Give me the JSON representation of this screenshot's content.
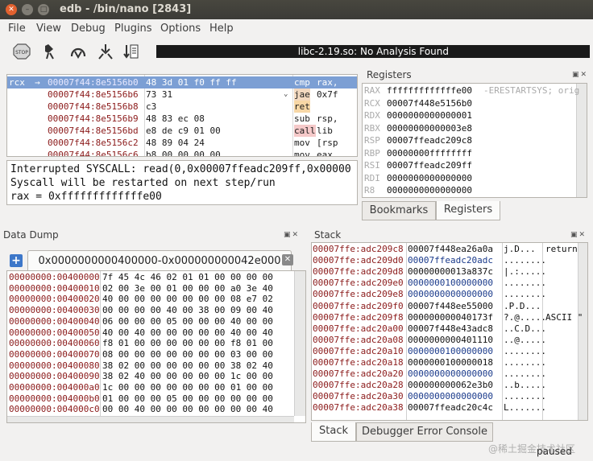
{
  "window": {
    "title": "edb - /bin/nano [2843]"
  },
  "menu": [
    "File",
    "View",
    "Debug",
    "Plugins",
    "Options",
    "Help"
  ],
  "toolbar": {
    "icons": [
      "stop-icon",
      "run-icon",
      "step-into-icon",
      "step-over-icon",
      "step-out-icon"
    ],
    "status_message": "libc-2.19.so: No Analysis Found"
  },
  "disassembly": {
    "rows": [
      {
        "label": "rcx",
        "addr": "00007f44:8e5156b0",
        "bytes": "48 3d 01 f0 ff ff",
        "mn": "cmp",
        "op": "rax,",
        "selected": true
      },
      {
        "label": "",
        "addr": "00007f44:8e5156b6",
        "bytes": "73 31",
        "mn": "jae",
        "op": "0x7f",
        "hl": "jmp"
      },
      {
        "label": "",
        "addr": "00007f44:8e5156b8",
        "bytes": "c3",
        "mn": "ret",
        "op": "",
        "hl": "ret"
      },
      {
        "label": "",
        "addr": "00007f44:8e5156b9",
        "bytes": "48 83 ec 08",
        "mn": "sub",
        "op": "rsp,",
        "hl": ""
      },
      {
        "label": "",
        "addr": "00007f44:8e5156bd",
        "bytes": "e8 de c9 01 00",
        "mn": "call",
        "op": "lib",
        "hl": "call"
      },
      {
        "label": "",
        "addr": "00007f44:8e5156c2",
        "bytes": "48 89 04 24",
        "mn": "mov",
        "op": "[rsp",
        "hl": ""
      },
      {
        "label": "",
        "addr": "00007f44:8e5156c6",
        "bytes": "b8 00 00 00 00",
        "mn": "mov",
        "op": "eax,",
        "hl": ""
      }
    ]
  },
  "info": {
    "line1": "Interrupted SYSCALL: read(0,0x00007ffeadc209ff,0x00000",
    "line2": "Syscall will be restarted on next step/run",
    "line3": "rax = 0xfffffffffffffe00"
  },
  "registers": {
    "title": "Registers",
    "rows": [
      {
        "name": "RAX",
        "val": "fffffffffffffe00",
        "note": "-ERESTARTSYS; orig"
      },
      {
        "name": "RCX",
        "val": "00007f448e5156b0",
        "note": ""
      },
      {
        "name": "RDX",
        "val": "0000000000000001",
        "note": ""
      },
      {
        "name": "RBX",
        "val": "00000000000003e8",
        "note": ""
      },
      {
        "name": "RSP",
        "val": "00007ffeadc209c8",
        "note": ""
      },
      {
        "name": "RBP",
        "val": "00000000ffffffff",
        "note": ""
      },
      {
        "name": "RSI",
        "val": "00007ffeadc209ff",
        "note": ""
      },
      {
        "name": "RDI",
        "val": "0000000000000000",
        "note": ""
      },
      {
        "name": "R8",
        "val": "0000000000000000",
        "note": ""
      }
    ],
    "tabs": [
      "Bookmarks",
      "Registers"
    ]
  },
  "data_dump": {
    "title": "Data Dump",
    "tab_label": "0x0000000000400000-0x000000000042e000",
    "rows": [
      {
        "addr": "00000000:00400000",
        "hex": "7f 45 4c 46 02 01 01 00 00 00 00"
      },
      {
        "addr": "00000000:00400010",
        "hex": "02 00 3e 00 01 00 00 00 a0 3e 40"
      },
      {
        "addr": "00000000:00400020",
        "hex": "40 00 00 00 00 00 00 00 08 e7 02"
      },
      {
        "addr": "00000000:00400030",
        "hex": "00 00 00 00 40 00 38 00 09 00 40"
      },
      {
        "addr": "00000000:00400040",
        "hex": "06 00 00 00 05 00 00 00 40 00 00"
      },
      {
        "addr": "00000000:00400050",
        "hex": "40 00 40 00 00 00 00 00 40 00 40"
      },
      {
        "addr": "00000000:00400060",
        "hex": "f8 01 00 00 00 00 00 00 f8 01 00"
      },
      {
        "addr": "00000000:00400070",
        "hex": "08 00 00 00 00 00 00 00 03 00 00"
      },
      {
        "addr": "00000000:00400080",
        "hex": "38 02 00 00 00 00 00 00 38 02 40"
      },
      {
        "addr": "00000000:00400090",
        "hex": "38 02 40 00 00 00 00 00 1c 00 00"
      },
      {
        "addr": "00000000:004000a0",
        "hex": "1c 00 00 00 00 00 00 00 01 00 00"
      },
      {
        "addr": "00000000:004000b0",
        "hex": "01 00 00 00 05 00 00 00 00 00 00"
      },
      {
        "addr": "00000000:004000c0",
        "hex": "00 00 40 00 00 00 00 00 00 00 40"
      }
    ]
  },
  "stack": {
    "title": "Stack",
    "rows": [
      {
        "addr": "00007ffe:adc209c8",
        "val": "00007f448ea26a0a",
        "asc": "j.D...",
        "cmt": "return",
        "ptr": false
      },
      {
        "addr": "00007ffe:adc209d0",
        "val": "00007ffeadc20adc",
        "asc": "........",
        "cmt": "",
        "ptr": true
      },
      {
        "addr": "00007ffe:adc209d8",
        "val": "00000000013a837c",
        "asc": "|.:.....",
        "cmt": "",
        "ptr": false
      },
      {
        "addr": "00007ffe:adc209e0",
        "val": "0000000100000000",
        "asc": "........",
        "cmt": "",
        "ptr": true
      },
      {
        "addr": "00007ffe:adc209e8",
        "val": "0000000000000000",
        "asc": "........",
        "cmt": "",
        "ptr": true
      },
      {
        "addr": "00007ffe:adc209f0",
        "val": "00007f448ee55000",
        "asc": ".P.D...",
        "cmt": "",
        "ptr": false
      },
      {
        "addr": "00007ffe:adc209f8",
        "val": "000000000040173f",
        "asc": "?.@.....",
        "cmt": "ASCII \"",
        "ptr": false
      },
      {
        "addr": "00007ffe:adc20a00",
        "val": "00007f448e43adc8",
        "asc": "..C.D...",
        "cmt": "",
        "ptr": false
      },
      {
        "addr": "00007ffe:adc20a08",
        "val": "0000000000401110",
        "asc": "..@.....",
        "cmt": "",
        "ptr": false
      },
      {
        "addr": "00007ffe:adc20a10",
        "val": "0000000100000000",
        "asc": "........",
        "cmt": "",
        "ptr": true
      },
      {
        "addr": "00007ffe:adc20a18",
        "val": "0000000100000018",
        "asc": "........",
        "cmt": "",
        "ptr": false
      },
      {
        "addr": "00007ffe:adc20a20",
        "val": "0000000000000000",
        "asc": "........",
        "cmt": "",
        "ptr": true
      },
      {
        "addr": "00007ffe:adc20a28",
        "val": "000000000062e3b0",
        "asc": "..b.....",
        "cmt": "",
        "ptr": false
      },
      {
        "addr": "00007ffe:adc20a30",
        "val": "0000000000000000",
        "asc": "........",
        "cmt": "",
        "ptr": true
      },
      {
        "addr": "00007ffe:adc20a38",
        "val": "00007ffeadc20c4c",
        "asc": "L.......",
        "cmt": "",
        "ptr": false
      }
    ],
    "tabs": [
      "Stack",
      "Debugger Error Console"
    ]
  },
  "status": {
    "state": "paused"
  },
  "watermark": "@稀土掘金技术社区"
}
